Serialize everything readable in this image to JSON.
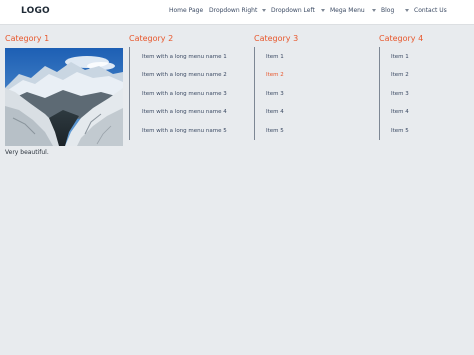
{
  "header": {
    "logo": "LOGO",
    "nav": [
      {
        "label": "Home Page"
      },
      {
        "label": "Dropdown Right"
      },
      {
        "label": "Dropdown Left",
        "caret": true
      },
      {
        "label": "Mega Menu",
        "caret": true
      },
      {
        "label": "Blog",
        "caret": true
      },
      {
        "label": "Contact Us",
        "caret": true
      }
    ]
  },
  "mega_menu": {
    "category1": {
      "title": "Category 1",
      "caption": "Very beautiful."
    },
    "category2": {
      "title": "Category 2",
      "items": [
        "Item with a long menu name 1",
        "Item with a long menu name 2",
        "Item with a long menu name 3",
        "Item with a long menu name 4",
        "Item with a long menu name 5"
      ]
    },
    "category3": {
      "title": "Category 3",
      "items": [
        "Item 1",
        "Item 2",
        "Item 3",
        "Item 4",
        "Item 5"
      ],
      "active_item": "Item 2"
    },
    "category4": {
      "title": "Category 4",
      "items": [
        "Item 1",
        "Item 2",
        "Item 3",
        "Item 4",
        "Item 5"
      ]
    }
  },
  "colors": {
    "accent": "#e8572c",
    "text": "#3b4a63",
    "background": "#e8ebee",
    "navbar": "#ffffff"
  }
}
